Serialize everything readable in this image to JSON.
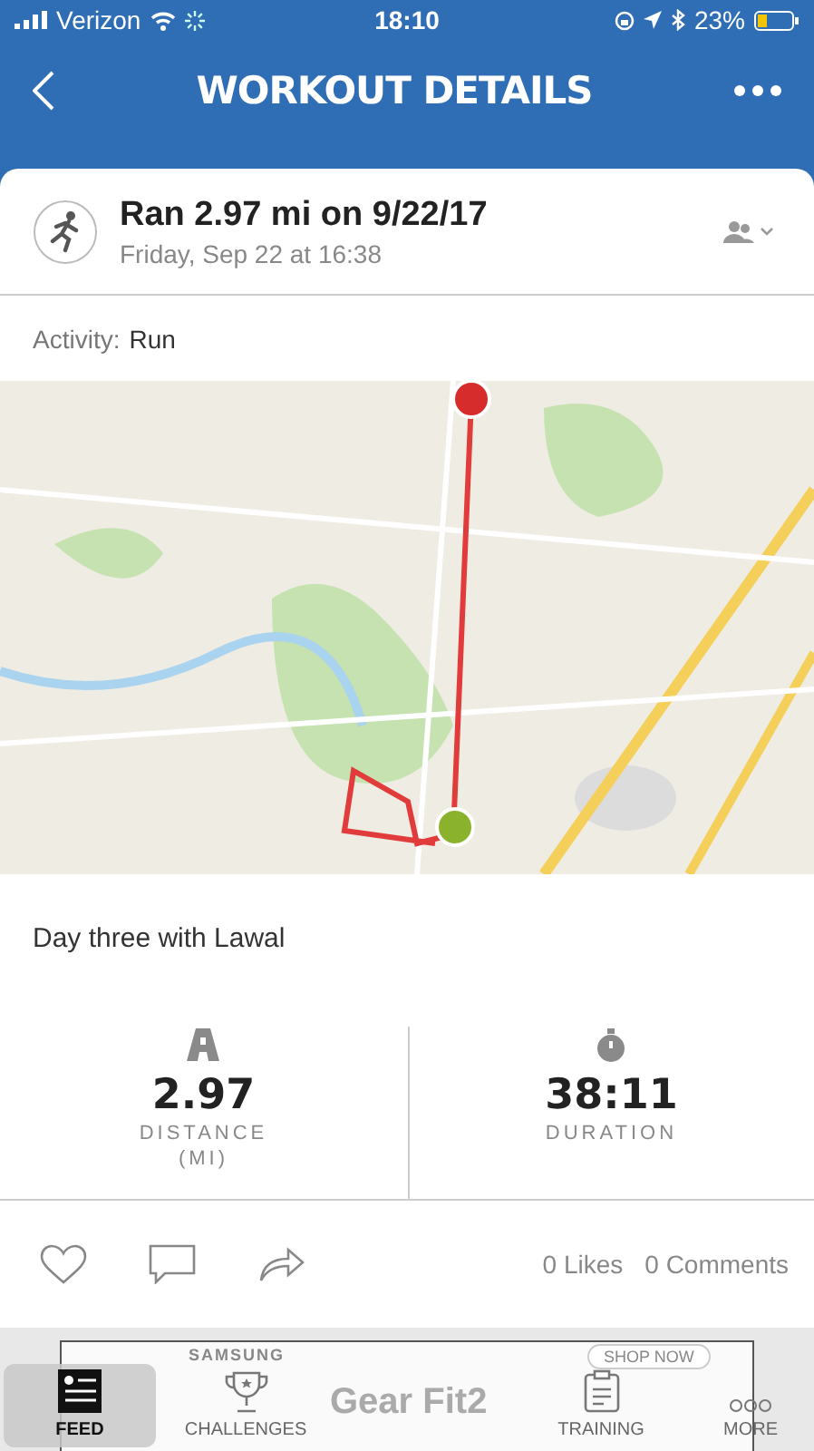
{
  "status_bar": {
    "carrier": "Verizon",
    "time": "18:10",
    "battery": "23%"
  },
  "header": {
    "title": "WORKOUT DETAILS"
  },
  "workout": {
    "title": "Ran 2.97 mi on 9/22/17",
    "subtitle": "Friday, Sep 22 at 16:38"
  },
  "activity": {
    "label": "Activity:",
    "value": "Run"
  },
  "note": "Day three with Lawal",
  "stats": [
    {
      "kind": "distance",
      "value": "2.97",
      "label": "DISTANCE",
      "unit": "(MI)"
    },
    {
      "kind": "duration",
      "value": "38:11",
      "label": "DURATION"
    }
  ],
  "social": {
    "likes": "0 Likes",
    "comments": "0 Comments"
  },
  "ad": {
    "brand": "SAMSUNG",
    "product": "Gear Fit2",
    "button": "SHOP NOW"
  },
  "tabs": [
    {
      "kind": "feed",
      "label": "FEED",
      "selected": true
    },
    {
      "kind": "challenges",
      "label": "CHALLENGES",
      "selected": false
    },
    {
      "kind": "gap"
    },
    {
      "kind": "training",
      "label": "TRAINING",
      "selected": false
    },
    {
      "kind": "more",
      "label": "MORE",
      "selected": false
    }
  ]
}
